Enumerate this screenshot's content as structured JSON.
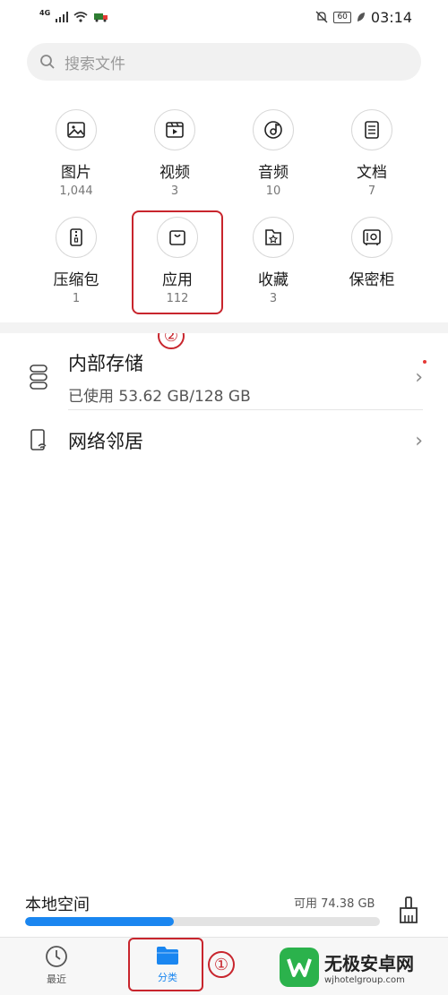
{
  "status_bar": {
    "network": "4G",
    "battery": "60",
    "time": "03:14"
  },
  "search": {
    "placeholder": "搜索文件"
  },
  "categories": [
    {
      "name": "图片",
      "count": "1,044",
      "icon": "image-icon"
    },
    {
      "name": "视频",
      "count": "3",
      "icon": "video-icon"
    },
    {
      "name": "音频",
      "count": "10",
      "icon": "audio-icon"
    },
    {
      "name": "文档",
      "count": "7",
      "icon": "document-icon"
    },
    {
      "name": "压缩包",
      "count": "1",
      "icon": "archive-icon"
    },
    {
      "name": "应用",
      "count": "112",
      "icon": "app-bag-icon"
    },
    {
      "name": "收藏",
      "count": "3",
      "icon": "favorite-icon"
    },
    {
      "name": "保密柜",
      "count": "",
      "icon": "safe-icon"
    }
  ],
  "annotations": {
    "step1": "①",
    "step2": "②"
  },
  "storage": {
    "internal": {
      "title": "内部存储",
      "used": "已使用 53.62 GB/128 GB"
    },
    "network": {
      "title": "网络邻居"
    }
  },
  "local_space": {
    "label": "本地空间",
    "available": "可用 74.38 GB",
    "used_fraction": 0.42
  },
  "nav": {
    "recent": "最近",
    "category": "分类"
  },
  "watermark": {
    "name": "无极安卓网",
    "url": "wjhotelgroup.com"
  },
  "colors": {
    "accent": "#1a86f0",
    "annotation": "#c8252d"
  }
}
